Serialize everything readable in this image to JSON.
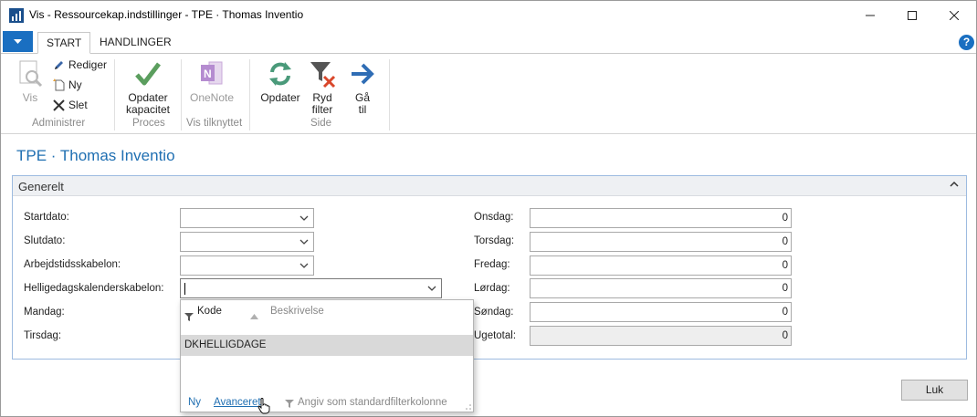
{
  "window": {
    "title": "Vis - Ressourcekap.indstillinger - TPE · Thomas  Inventio"
  },
  "ribbon": {
    "tabs": [
      "START",
      "HANDLINGER"
    ],
    "active_tab": "START",
    "help_label": "?",
    "groups": {
      "administrer": {
        "label": "Administrer",
        "vis": "Vis",
        "rediger": "Rediger",
        "ny": "Ny",
        "slet": "Slet"
      },
      "proces": {
        "label": "Proces",
        "opdater_kapacitet_1": "Opdater",
        "opdater_kapacitet_2": "kapacitet"
      },
      "vis_tilknyttet": {
        "label": "Vis tilknyttet",
        "onenote": "OneNote"
      },
      "side": {
        "label": "Side",
        "opdater": "Opdater",
        "ryd_filter_1": "Ryd",
        "ryd_filter_2": "filter",
        "gaa_til_1": "Gå",
        "gaa_til_2": "til"
      }
    }
  },
  "page": {
    "title": "TPE · Thomas  Inventio"
  },
  "general": {
    "header": "Generelt",
    "left_fields": {
      "startdato": "Startdato:",
      "slutdato": "Slutdato:",
      "arbejdstidsskabelon": "Arbejdstidsskabelon:",
      "helligdagskalenderskabelon": "Helligedagskalenderskabelon:",
      "mandag": "Mandag:",
      "tirsdag": "Tirsdag:"
    },
    "right_fields": [
      {
        "label": "Onsdag:",
        "value": "0"
      },
      {
        "label": "Torsdag:",
        "value": "0"
      },
      {
        "label": "Fredag:",
        "value": "0"
      },
      {
        "label": "Lørdag:",
        "value": "0"
      },
      {
        "label": "Søndag:",
        "value": "0"
      },
      {
        "label": "Ugetotal:",
        "value": "0"
      }
    ]
  },
  "dropdown": {
    "columns": [
      "Kode",
      "Beskrivelse"
    ],
    "rows": [
      {
        "kode": "DKHELLIGDAGE",
        "beskrivelse": ""
      }
    ],
    "footer": {
      "new": "Ny",
      "advanced": "Avanceret",
      "set_default_filter": "Angiv som standardfilterkolonne"
    }
  },
  "buttons": {
    "close": "Luk"
  }
}
